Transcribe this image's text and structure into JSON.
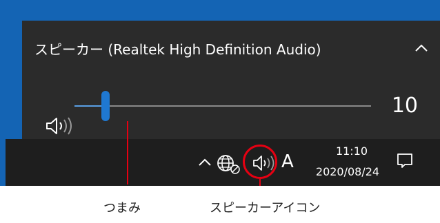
{
  "flyout": {
    "device_name": "スピーカー (Realtek High Definition Audio)",
    "volume_value": "10",
    "volume_fraction": 0.1
  },
  "taskbar": {
    "ime_mode": "A",
    "clock_time": "11:10",
    "clock_date": "2020/08/24"
  },
  "callouts": {
    "knob_label": "つまみ",
    "speaker_icon_label": "スピーカーアイコン"
  },
  "colors": {
    "accent": "#1f78d1",
    "highlight": "#e60012",
    "flyout_bg": "#2b2b2b",
    "taskbar_bg": "#1e1e1e"
  },
  "icons": {
    "collapse": "chevron-up-icon",
    "flyout_speaker": "speaker-icon",
    "tray_overflow": "chevron-up-icon",
    "network": "network-globe-icon",
    "tray_speaker": "speaker-icon",
    "notifications": "notification-icon"
  }
}
